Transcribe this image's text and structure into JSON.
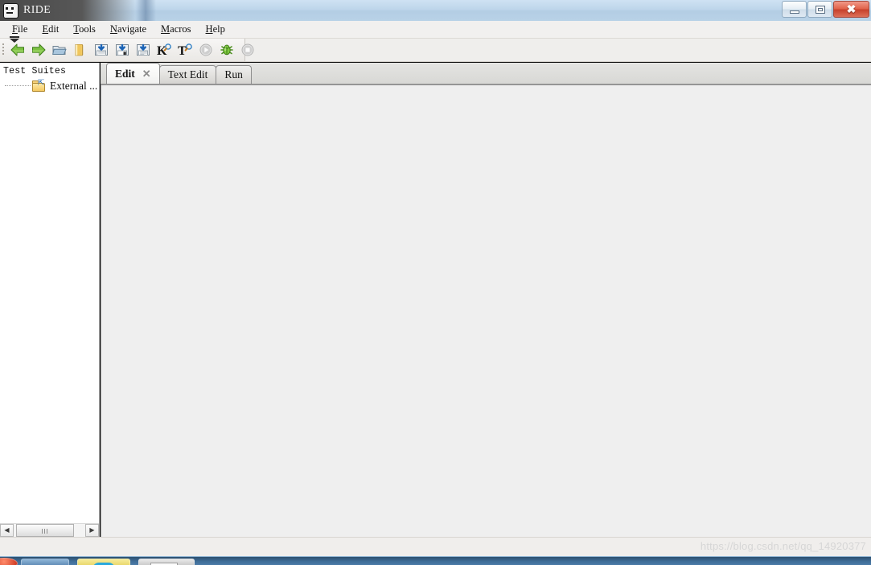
{
  "window": {
    "title": "RIDE",
    "app_icon": "robot-icon",
    "controls": {
      "minimize": "minimize-button",
      "maximize": "maximize-button",
      "close": "close-button",
      "close_glyph": "✖"
    }
  },
  "menubar": {
    "items": [
      {
        "label": "File",
        "mnemonic": "F",
        "rest": "ile"
      },
      {
        "label": "Edit",
        "mnemonic": "E",
        "rest": "dit"
      },
      {
        "label": "Tools",
        "mnemonic": "T",
        "rest": "ools"
      },
      {
        "label": "Navigate",
        "mnemonic": "N",
        "rest": "avigate"
      },
      {
        "label": "Macros",
        "mnemonic": "M",
        "rest": "acros"
      },
      {
        "label": "Help",
        "mnemonic": "H",
        "rest": "elp"
      }
    ]
  },
  "toolbar": {
    "overflow_label": "toolbar-overflow-chevron",
    "buttons": [
      {
        "name": "back-arrow-icon",
        "title": "Go Back"
      },
      {
        "name": "forward-arrow-icon",
        "title": "Go Forward"
      },
      {
        "name": "open-directory-icon",
        "title": "Open Directory"
      },
      {
        "name": "open-file-icon",
        "title": "Open File"
      },
      {
        "name": "save-icon",
        "title": "Save"
      },
      {
        "name": "save-as-icon",
        "title": "Save As"
      },
      {
        "name": "save-all-icon",
        "title": "Save All"
      },
      {
        "name": "search-keyword-icon",
        "title": "Search Keywords",
        "glyph": "K"
      },
      {
        "name": "search-tests-icon",
        "title": "Search Tests",
        "glyph": "T"
      },
      {
        "name": "run-icon",
        "title": "Start Running"
      },
      {
        "name": "debug-icon",
        "title": "Start Debugging"
      },
      {
        "name": "stop-icon",
        "title": "Stop Running"
      }
    ]
  },
  "sidebar": {
    "header": "Test Suites",
    "tree": [
      {
        "label": "External ...",
        "icon": "external-folder-icon"
      }
    ],
    "hscrollbar": {
      "left_arrow": "◀",
      "right_arrow": "▶"
    }
  },
  "main": {
    "tabs": [
      {
        "label": "Edit",
        "active": true,
        "closable": true,
        "close_glyph": "✕"
      },
      {
        "label": "Text Edit",
        "active": false,
        "closable": false
      },
      {
        "label": "Run",
        "active": false,
        "closable": false
      }
    ],
    "content": ""
  },
  "statusbar": {
    "watermark": "https://blog.csdn.net/qq_14920377"
  },
  "colors": {
    "titlebar": "#b3cde4",
    "close_button": "#c7412c",
    "content_bg": "#efefef",
    "sidebar_bg": "#ffffff",
    "taskbar": "#3f6d97",
    "accent_green": "#6cb33f"
  }
}
